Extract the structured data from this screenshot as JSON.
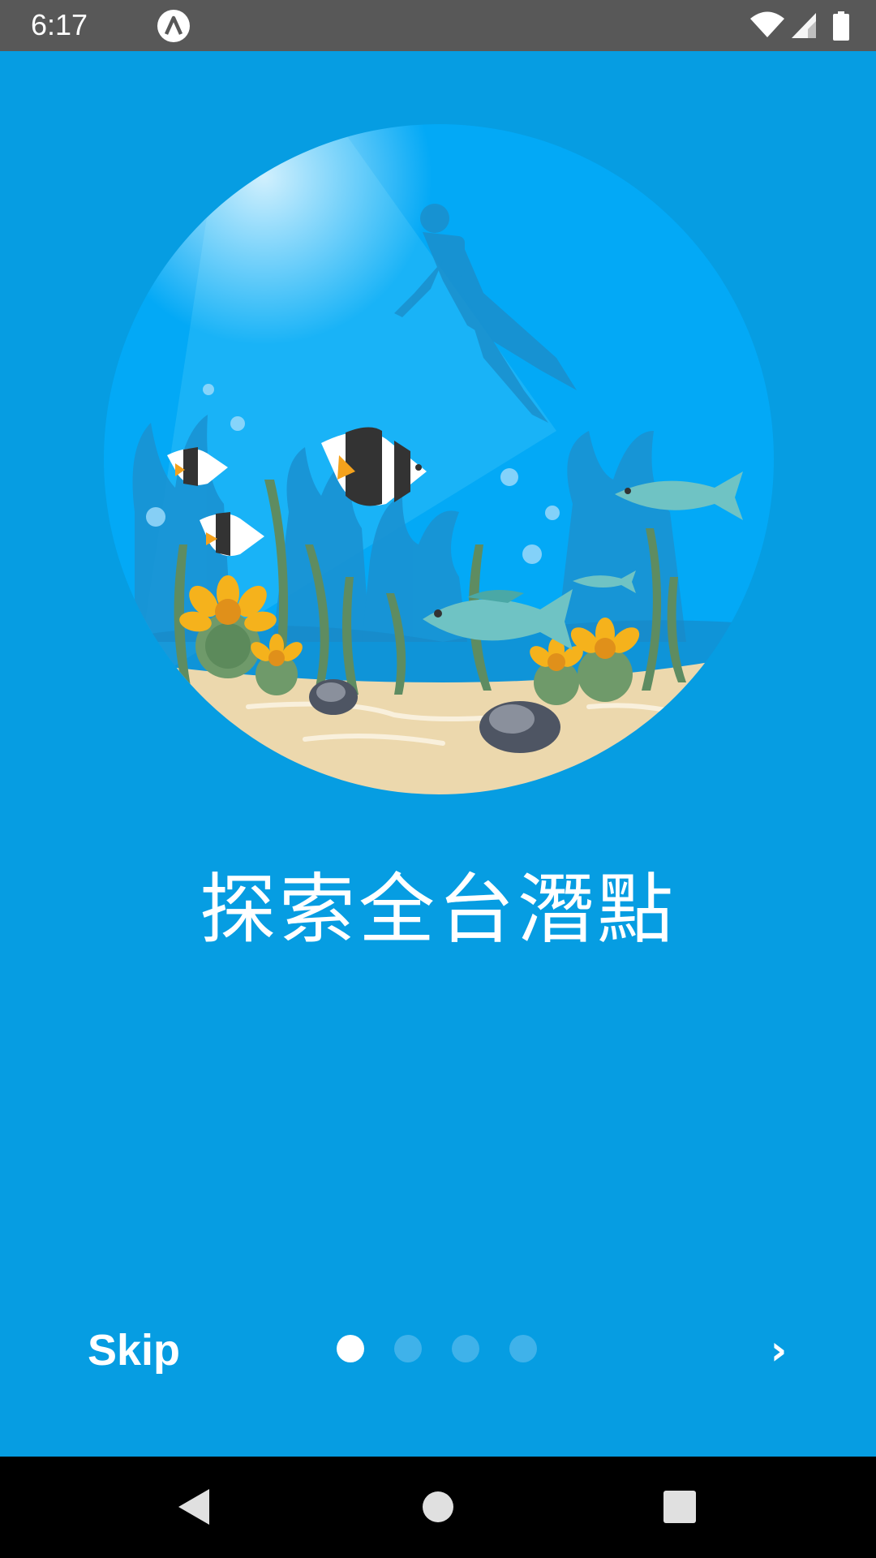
{
  "status_bar": {
    "time": "6:17",
    "app_badge_icon": "lambda-badge-icon",
    "icons": [
      "wifi-icon",
      "cellular-signal-icon",
      "battery-icon"
    ]
  },
  "hero": {
    "illustration": "underwater-scene-diver-fish-coral"
  },
  "headline": "探索全台潛點",
  "controls": {
    "skip_label": "Skip",
    "next_label": "›",
    "pages_total": 4,
    "current_page": 1
  },
  "nav_bar": {
    "back": "back-triangle-icon",
    "home": "home-circle-icon",
    "recents": "recents-square-icon"
  },
  "colors": {
    "background": "#069de2",
    "status_bar": "#585858",
    "dot_active": "#ffffff",
    "dot_inactive": "#3fb2ea"
  }
}
